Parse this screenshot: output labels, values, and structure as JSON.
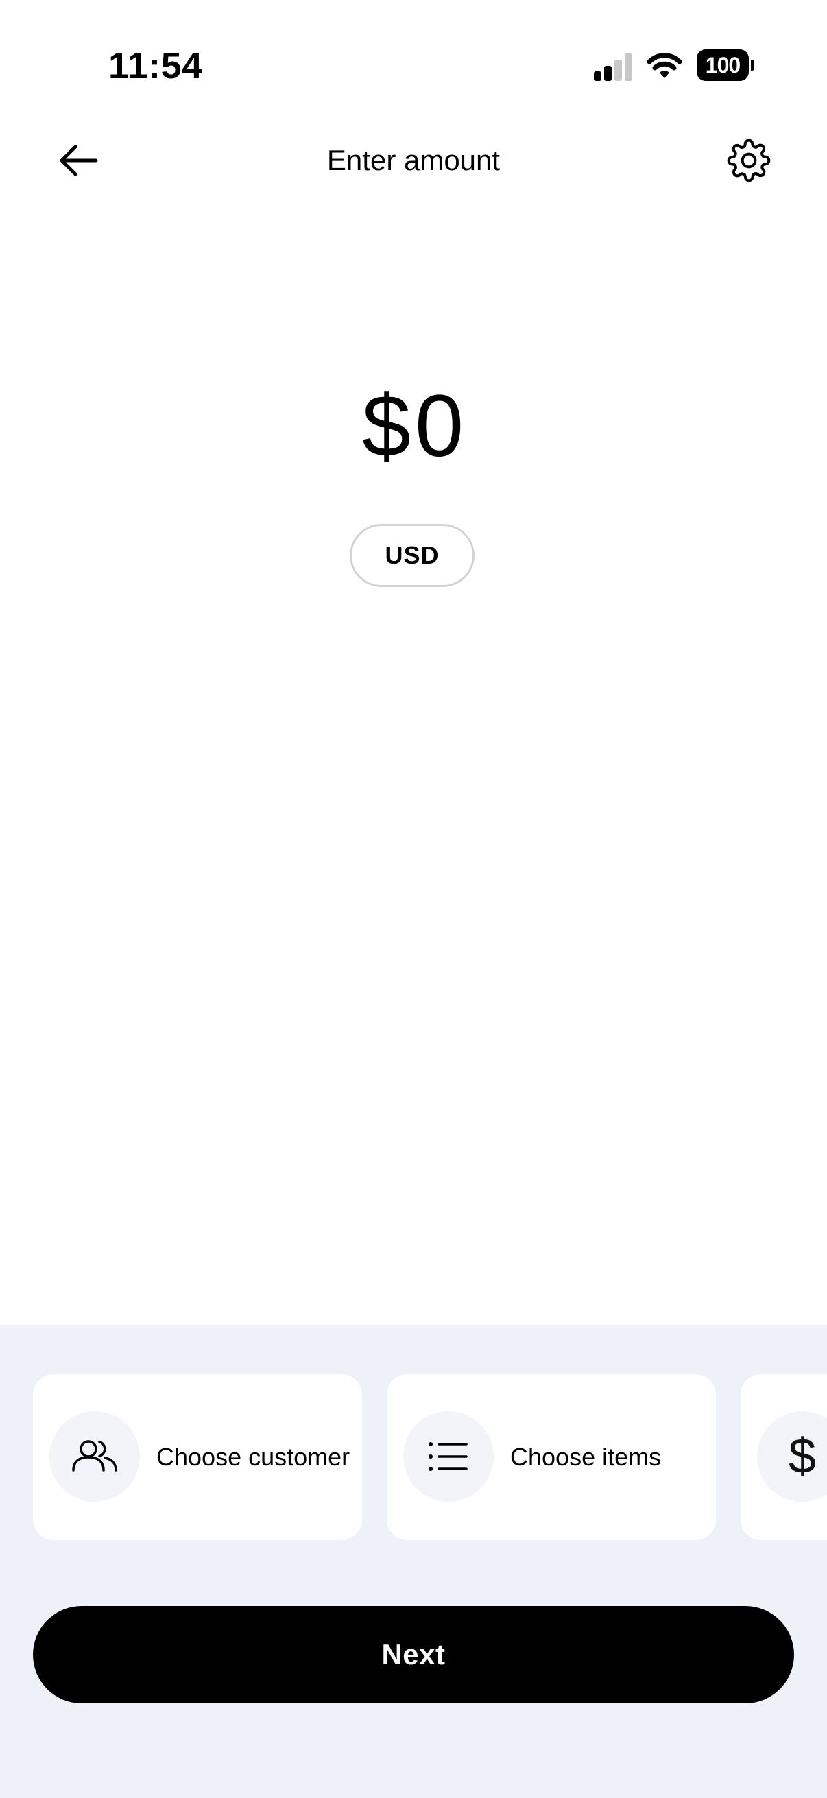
{
  "status_bar": {
    "time": "11:54",
    "battery": "100",
    "signal_icon": "cellular-signal-icon",
    "wifi_icon": "wifi-icon"
  },
  "header": {
    "title": "Enter amount",
    "back_icon": "arrow-left-icon",
    "settings_icon": "gear-icon"
  },
  "amount": {
    "currency_symbol": "$",
    "value": "0",
    "currency_code": "USD"
  },
  "actions": [
    {
      "label": "Choose customer",
      "icon": "people-icon"
    },
    {
      "label": "Choose items",
      "icon": "list-icon"
    },
    {
      "label": "",
      "icon": "dollar-icon",
      "glyph": "$"
    }
  ],
  "next_label": "Next",
  "colors": {
    "bottom_panel": "#eff1f8",
    "primary_button": "#000000",
    "card": "#ffffff"
  }
}
